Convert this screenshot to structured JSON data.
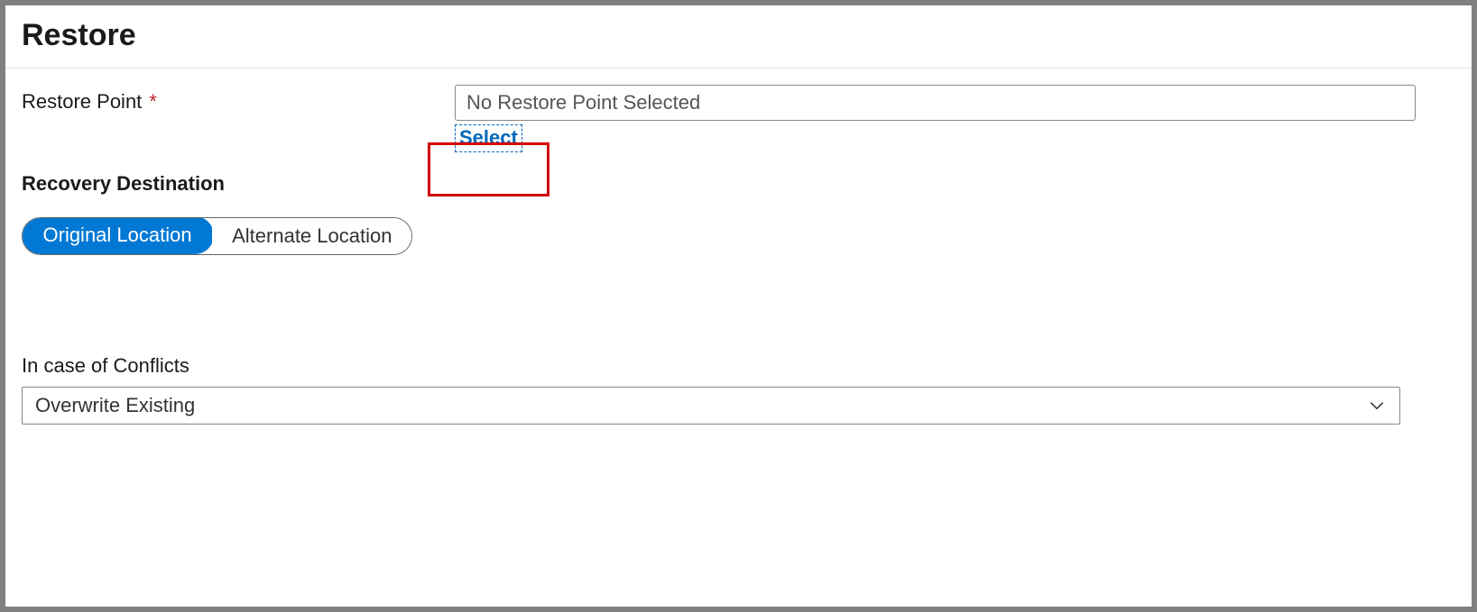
{
  "header": {
    "title": "Restore"
  },
  "restorePoint": {
    "label": "Restore Point",
    "required": "*",
    "value": "No Restore Point Selected",
    "selectLink": "Select"
  },
  "recoveryDestination": {
    "label": "Recovery Destination",
    "options": {
      "original": "Original Location",
      "alternate": "Alternate Location"
    }
  },
  "conflicts": {
    "label": "In case of Conflicts",
    "value": "Overwrite Existing"
  }
}
